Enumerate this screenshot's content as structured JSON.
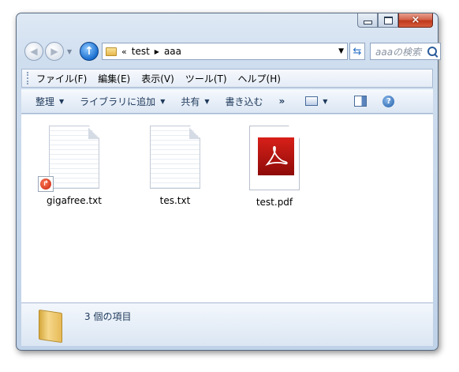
{
  "window": {
    "caption": {
      "minimize_glyph": "minimize-icon",
      "maximize_glyph": "maximize-icon",
      "close_glyph": "×"
    }
  },
  "nav": {
    "breadcrumb_prefix": "«",
    "breadcrumb": [
      "test",
      "aaa"
    ],
    "search_placeholder": "aaaの検索"
  },
  "menu": [
    "ファイル(F)",
    "編集(E)",
    "表示(V)",
    "ツール(T)",
    "ヘルプ(H)"
  ],
  "commands": {
    "organize": "整理",
    "library": "ライブラリに追加",
    "share": "共有",
    "burn": "書き込む",
    "more": "»",
    "help": "?"
  },
  "files": [
    {
      "name": "gigafree.txt",
      "type": "text-shortcut"
    },
    {
      "name": "tes.txt",
      "type": "text"
    },
    {
      "name": "test.pdf",
      "type": "pdf"
    }
  ],
  "status": {
    "item_count": "3 個の項目"
  },
  "colors": {
    "pdf_red": "#c81a12",
    "close_red": "#c0391c",
    "accent_blue": "#1a6fd0"
  }
}
